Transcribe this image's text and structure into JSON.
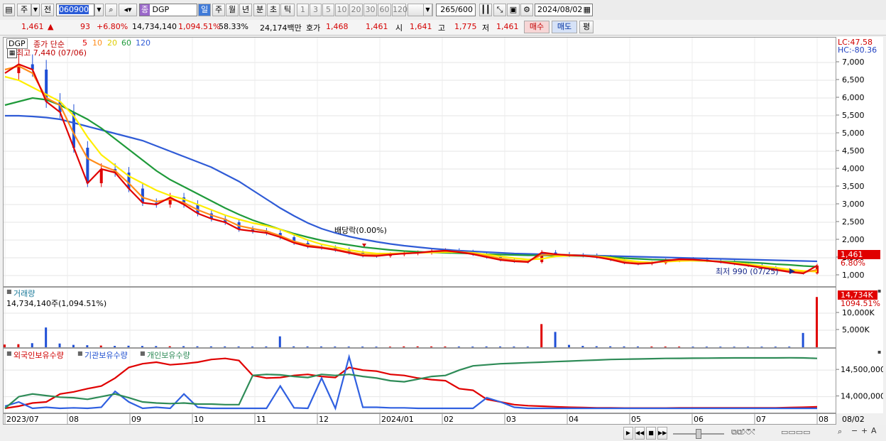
{
  "toolbar": {
    "mode_label": "주",
    "prev_label": "전",
    "code": "060900",
    "name_badge": "종",
    "name": "DGP",
    "periods": [
      "일",
      "주",
      "월",
      "년",
      "분",
      "초",
      "틱"
    ],
    "intervals": [
      "1",
      "3",
      "5",
      "10",
      "20",
      "30",
      "60",
      "120"
    ],
    "count_value": "265",
    "count_total": "/600",
    "date": "2024/08/02"
  },
  "quote": {
    "price": "1,461",
    "arrow": "▲",
    "change": "93",
    "change_pct": "+6.80%",
    "volume": "14,734,140",
    "volume_ratio": "1,094.51%",
    "turnover": "58.33%",
    "amount": "24,174백만",
    "bid_label": "호가",
    "bid1": "1,468",
    "bid2": "1,461",
    "open_label": "시",
    "open": "1,641",
    "high_label": "고",
    "high": "1,775",
    "low_label": "저",
    "low": "1,461",
    "buy_label": "매수",
    "sell_label": "매도",
    "eval_label": "평"
  },
  "price_panel": {
    "symbol": "DGP",
    "legend_prefix": "종가 단순",
    "ma_labels": [
      "5",
      "10",
      "20",
      "60",
      "120"
    ],
    "high_note": "최고 7,440 (07/06)",
    "low_note": "최저 990 (07/25)",
    "dividend_note": "배당락(0.00%)",
    "lc": "LC:47.58",
    "hc": "HC:-80.36",
    "last_price": "1,461",
    "last_pct": "6.80%"
  },
  "volume_panel": {
    "title": "거래량",
    "summary": "14,734,140주(1,094.51%)",
    "last_value": "14,734K",
    "last_pct": "1094.51%"
  },
  "holding_panel": {
    "legend": [
      "외국인보유수량",
      "기관보유수량",
      "개인보유수량"
    ]
  },
  "colors": {
    "ma5": "#e00000",
    "ma10": "#ff8c1a",
    "ma20": "#ffee00",
    "ma60": "#1f9a3a",
    "ma120": "#2f5bd6",
    "up": "#e00000",
    "down": "#1f4fd6",
    "foreign": "#e00000",
    "institution": "#3060e0",
    "individual": "#2e8b57"
  },
  "chart_data": [
    {
      "type": "line",
      "title": "DGP",
      "x_ticks": [
        "2023/07",
        "08",
        "09",
        "10",
        "11",
        "12",
        "2024/01",
        "02",
        "03",
        "04",
        "05",
        "06",
        "07",
        "08"
      ],
      "y_ticks": [
        "7,000",
        "6,500",
        "6,000",
        "5,500",
        "5,000",
        "4,500",
        "4,000",
        "3,500",
        "3,000",
        "2,500",
        "2,000",
        "1,500",
        "1,000"
      ],
      "ylim": [
        700,
        7700
      ],
      "series": [
        {
          "name": "5",
          "values": [
            6700,
            6950,
            6800,
            5900,
            5600,
            4600,
            3600,
            4000,
            3900,
            3450,
            3050,
            3000,
            3200,
            3000,
            2750,
            2600,
            2500,
            2300,
            2250,
            2200,
            2080,
            1920,
            1820,
            1780,
            1720,
            1640,
            1560,
            1550,
            1590,
            1620,
            1640,
            1680,
            1700,
            1660,
            1600,
            1520,
            1440,
            1400,
            1380,
            1650,
            1600,
            1570,
            1560,
            1520,
            1450,
            1360,
            1330,
            1350,
            1420,
            1460,
            1450,
            1420,
            1380,
            1330,
            1280,
            1220,
            1160,
            1100,
            1060,
            1280
          ]
        },
        {
          "name": "10",
          "values": [
            6800,
            6900,
            6700,
            6000,
            5800,
            5000,
            4300,
            4100,
            3950,
            3600,
            3200,
            3080,
            3150,
            3050,
            2850,
            2700,
            2580,
            2400,
            2320,
            2250,
            2120,
            1960,
            1860,
            1800,
            1740,
            1660,
            1600,
            1580,
            1600,
            1620,
            1640,
            1670,
            1690,
            1670,
            1620,
            1550,
            1480,
            1430,
            1400,
            1580,
            1590,
            1580,
            1560,
            1530,
            1470,
            1390,
            1350,
            1360,
            1410,
            1440,
            1440,
            1420,
            1390,
            1340,
            1290,
            1230,
            1180,
            1120,
            1090,
            1160
          ]
        },
        {
          "name": "20",
          "values": [
            6600,
            6500,
            6300,
            6100,
            5900,
            5500,
            4900,
            4400,
            4100,
            3800,
            3600,
            3400,
            3250,
            3150,
            3000,
            2850,
            2700,
            2580,
            2480,
            2400,
            2300,
            2150,
            2000,
            1880,
            1800,
            1720,
            1660,
            1620,
            1620,
            1630,
            1640,
            1650,
            1660,
            1660,
            1640,
            1590,
            1540,
            1490,
            1450,
            1470,
            1540,
            1560,
            1560,
            1540,
            1500,
            1440,
            1390,
            1370,
            1390,
            1410,
            1420,
            1410,
            1390,
            1360,
            1320,
            1270,
            1220,
            1170,
            1130,
            1110
          ]
        },
        {
          "name": "60",
          "values": [
            5800,
            5900,
            6000,
            5950,
            5800,
            5600,
            5400,
            5150,
            4850,
            4550,
            4250,
            3950,
            3700,
            3500,
            3300,
            3100,
            2900,
            2720,
            2560,
            2430,
            2300,
            2180,
            2080,
            1990,
            1920,
            1860,
            1800,
            1760,
            1720,
            1690,
            1670,
            1650,
            1640,
            1630,
            1620,
            1600,
            1590,
            1580,
            1570,
            1570,
            1560,
            1560,
            1550,
            1540,
            1520,
            1490,
            1470,
            1450,
            1440,
            1430,
            1420,
            1410,
            1400,
            1390,
            1370,
            1350,
            1320,
            1300,
            1270,
            1250
          ]
        },
        {
          "name": "120",
          "values": [
            5500,
            5500,
            5480,
            5450,
            5400,
            5300,
            5200,
            5100,
            5000,
            4900,
            4800,
            4650,
            4500,
            4350,
            4200,
            4050,
            3850,
            3650,
            3400,
            3150,
            2900,
            2680,
            2480,
            2320,
            2200,
            2100,
            2020,
            1950,
            1890,
            1840,
            1800,
            1760,
            1730,
            1700,
            1680,
            1660,
            1640,
            1620,
            1610,
            1600,
            1590,
            1580,
            1570,
            1560,
            1550,
            1540,
            1530,
            1520,
            1510,
            1500,
            1490,
            1480,
            1470,
            1460,
            1450,
            1440,
            1430,
            1420,
            1410,
            1400
          ]
        }
      ]
    },
    {
      "type": "bar",
      "title": "거래량",
      "y_ticks": [
        "10,000K",
        "5,000K"
      ],
      "ylim": [
        0,
        15000000
      ],
      "values": [
        800000,
        900000,
        1200000,
        5800000,
        1100000,
        700000,
        600000,
        500000,
        400000,
        450000,
        380000,
        350000,
        300000,
        320000,
        280000,
        260000,
        250000,
        230000,
        220000,
        240000,
        3200000,
        260000,
        240000,
        230000,
        220000,
        200000,
        210000,
        190000,
        180000,
        250000,
        260000,
        240000,
        230000,
        220000,
        210000,
        240000,
        230000,
        220000,
        200000,
        6800000,
        4500000,
        700000,
        400000,
        300000,
        280000,
        250000,
        230000,
        220000,
        210000,
        200000,
        190000,
        185000,
        180000,
        175000,
        170000,
        180000,
        190000,
        200000,
        4200000,
        14734140
      ]
    },
    {
      "type": "line",
      "title": "보유수량",
      "y_ticks": [
        "14,500,000",
        "14,000,000"
      ],
      "series": [
        {
          "name": "외국인보유수량",
          "values": [
            13780,
            13820,
            13880,
            13900,
            14050,
            14090,
            14150,
            14200,
            14350,
            14550,
            14620,
            14650,
            14600,
            14620,
            14650,
            14700,
            14720,
            14680,
            14400,
            14350,
            14360,
            14400,
            14420,
            14380,
            14360,
            14550,
            14500,
            14480,
            14420,
            14400,
            14350,
            14320,
            14300,
            14150,
            14120,
            13950,
            13900,
            13850,
            13830,
            13820,
            13810,
            13800,
            13795,
            13790,
            13790,
            13785,
            13785,
            13785,
            13785,
            13790,
            13790,
            13790,
            13790,
            13790,
            13790,
            13790,
            13790,
            13795,
            13800,
            13810
          ]
        },
        {
          "name": "기관보유수량",
          "values": [
            13820,
            13900,
            13780,
            13800,
            13780,
            13790,
            13780,
            13800,
            14100,
            13900,
            13780,
            13800,
            13780,
            14050,
            13800,
            13780,
            13780,
            13780,
            13780,
            13780,
            14200,
            13790,
            13780,
            14350,
            13780,
            14750,
            13800,
            13800,
            13790,
            13790,
            13780,
            13780,
            13780,
            13780,
            13780,
            13980,
            13900,
            13800,
            13780,
            13780,
            13780,
            13780,
            13780,
            13780,
            13780,
            13780,
            13780,
            13780,
            13780,
            13780,
            13780,
            13780,
            13780,
            13780,
            13780,
            13780,
            13780,
            13780,
            13780,
            13780
          ]
        },
        {
          "name": "개인보유수량",
          "values": [
            13780,
            14000,
            14050,
            14020,
            13990,
            13980,
            13950,
            14000,
            14050,
            13980,
            13900,
            13880,
            13870,
            13880,
            13860,
            13860,
            13850,
            13850,
            14400,
            14420,
            14410,
            14380,
            14360,
            14420,
            14400,
            14420,
            14380,
            14350,
            14300,
            14280,
            14330,
            14380,
            14400,
            14500,
            14580,
            14600,
            14620,
            14630,
            14640,
            14650,
            14660,
            14670,
            14680,
            14690,
            14700,
            14705,
            14710,
            14715,
            14720,
            14722,
            14724,
            14726,
            14728,
            14730,
            14730,
            14730,
            14730,
            14732,
            14730,
            14720
          ]
        }
      ]
    }
  ]
}
